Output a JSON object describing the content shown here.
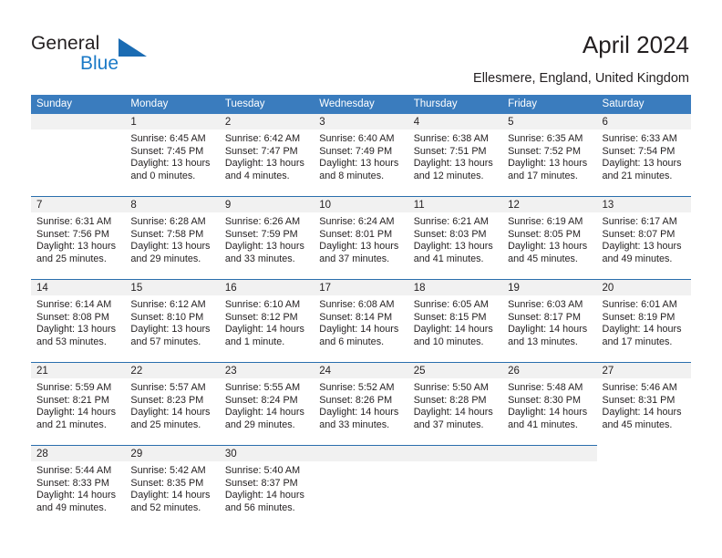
{
  "brand": {
    "name_part1": "General",
    "name_part2": "Blue",
    "accent_color": "#1b7ac7",
    "triangle_color": "#1b6cb3"
  },
  "header": {
    "title": "April 2024",
    "subtitle": "Ellesmere, England, United Kingdom"
  },
  "theme": {
    "header_row_bg": "#3a7cbe",
    "row_divider": "#2a6ead",
    "daynum_band_bg": "#f1f1f1",
    "text_color": "#231f20"
  },
  "calendar": {
    "weekday_headers": [
      "Sunday",
      "Monday",
      "Tuesday",
      "Wednesday",
      "Thursday",
      "Friday",
      "Saturday"
    ],
    "weeks": [
      [
        {
          "day": "",
          "sunrise": "",
          "sunset": "",
          "daylight1": "",
          "daylight2": ""
        },
        {
          "day": "1",
          "sunrise": "Sunrise: 6:45 AM",
          "sunset": "Sunset: 7:45 PM",
          "daylight1": "Daylight: 13 hours",
          "daylight2": "and 0 minutes."
        },
        {
          "day": "2",
          "sunrise": "Sunrise: 6:42 AM",
          "sunset": "Sunset: 7:47 PM",
          "daylight1": "Daylight: 13 hours",
          "daylight2": "and 4 minutes."
        },
        {
          "day": "3",
          "sunrise": "Sunrise: 6:40 AM",
          "sunset": "Sunset: 7:49 PM",
          "daylight1": "Daylight: 13 hours",
          "daylight2": "and 8 minutes."
        },
        {
          "day": "4",
          "sunrise": "Sunrise: 6:38 AM",
          "sunset": "Sunset: 7:51 PM",
          "daylight1": "Daylight: 13 hours",
          "daylight2": "and 12 minutes."
        },
        {
          "day": "5",
          "sunrise": "Sunrise: 6:35 AM",
          "sunset": "Sunset: 7:52 PM",
          "daylight1": "Daylight: 13 hours",
          "daylight2": "and 17 minutes."
        },
        {
          "day": "6",
          "sunrise": "Sunrise: 6:33 AM",
          "sunset": "Sunset: 7:54 PM",
          "daylight1": "Daylight: 13 hours",
          "daylight2": "and 21 minutes."
        }
      ],
      [
        {
          "day": "7",
          "sunrise": "Sunrise: 6:31 AM",
          "sunset": "Sunset: 7:56 PM",
          "daylight1": "Daylight: 13 hours",
          "daylight2": "and 25 minutes."
        },
        {
          "day": "8",
          "sunrise": "Sunrise: 6:28 AM",
          "sunset": "Sunset: 7:58 PM",
          "daylight1": "Daylight: 13 hours",
          "daylight2": "and 29 minutes."
        },
        {
          "day": "9",
          "sunrise": "Sunrise: 6:26 AM",
          "sunset": "Sunset: 7:59 PM",
          "daylight1": "Daylight: 13 hours",
          "daylight2": "and 33 minutes."
        },
        {
          "day": "10",
          "sunrise": "Sunrise: 6:24 AM",
          "sunset": "Sunset: 8:01 PM",
          "daylight1": "Daylight: 13 hours",
          "daylight2": "and 37 minutes."
        },
        {
          "day": "11",
          "sunrise": "Sunrise: 6:21 AM",
          "sunset": "Sunset: 8:03 PM",
          "daylight1": "Daylight: 13 hours",
          "daylight2": "and 41 minutes."
        },
        {
          "day": "12",
          "sunrise": "Sunrise: 6:19 AM",
          "sunset": "Sunset: 8:05 PM",
          "daylight1": "Daylight: 13 hours",
          "daylight2": "and 45 minutes."
        },
        {
          "day": "13",
          "sunrise": "Sunrise: 6:17 AM",
          "sunset": "Sunset: 8:07 PM",
          "daylight1": "Daylight: 13 hours",
          "daylight2": "and 49 minutes."
        }
      ],
      [
        {
          "day": "14",
          "sunrise": "Sunrise: 6:14 AM",
          "sunset": "Sunset: 8:08 PM",
          "daylight1": "Daylight: 13 hours",
          "daylight2": "and 53 minutes."
        },
        {
          "day": "15",
          "sunrise": "Sunrise: 6:12 AM",
          "sunset": "Sunset: 8:10 PM",
          "daylight1": "Daylight: 13 hours",
          "daylight2": "and 57 minutes."
        },
        {
          "day": "16",
          "sunrise": "Sunrise: 6:10 AM",
          "sunset": "Sunset: 8:12 PM",
          "daylight1": "Daylight: 14 hours",
          "daylight2": "and 1 minute."
        },
        {
          "day": "17",
          "sunrise": "Sunrise: 6:08 AM",
          "sunset": "Sunset: 8:14 PM",
          "daylight1": "Daylight: 14 hours",
          "daylight2": "and 6 minutes."
        },
        {
          "day": "18",
          "sunrise": "Sunrise: 6:05 AM",
          "sunset": "Sunset: 8:15 PM",
          "daylight1": "Daylight: 14 hours",
          "daylight2": "and 10 minutes."
        },
        {
          "day": "19",
          "sunrise": "Sunrise: 6:03 AM",
          "sunset": "Sunset: 8:17 PM",
          "daylight1": "Daylight: 14 hours",
          "daylight2": "and 13 minutes."
        },
        {
          "day": "20",
          "sunrise": "Sunrise: 6:01 AM",
          "sunset": "Sunset: 8:19 PM",
          "daylight1": "Daylight: 14 hours",
          "daylight2": "and 17 minutes."
        }
      ],
      [
        {
          "day": "21",
          "sunrise": "Sunrise: 5:59 AM",
          "sunset": "Sunset: 8:21 PM",
          "daylight1": "Daylight: 14 hours",
          "daylight2": "and 21 minutes."
        },
        {
          "day": "22",
          "sunrise": "Sunrise: 5:57 AM",
          "sunset": "Sunset: 8:23 PM",
          "daylight1": "Daylight: 14 hours",
          "daylight2": "and 25 minutes."
        },
        {
          "day": "23",
          "sunrise": "Sunrise: 5:55 AM",
          "sunset": "Sunset: 8:24 PM",
          "daylight1": "Daylight: 14 hours",
          "daylight2": "and 29 minutes."
        },
        {
          "day": "24",
          "sunrise": "Sunrise: 5:52 AM",
          "sunset": "Sunset: 8:26 PM",
          "daylight1": "Daylight: 14 hours",
          "daylight2": "and 33 minutes."
        },
        {
          "day": "25",
          "sunrise": "Sunrise: 5:50 AM",
          "sunset": "Sunset: 8:28 PM",
          "daylight1": "Daylight: 14 hours",
          "daylight2": "and 37 minutes."
        },
        {
          "day": "26",
          "sunrise": "Sunrise: 5:48 AM",
          "sunset": "Sunset: 8:30 PM",
          "daylight1": "Daylight: 14 hours",
          "daylight2": "and 41 minutes."
        },
        {
          "day": "27",
          "sunrise": "Sunrise: 5:46 AM",
          "sunset": "Sunset: 8:31 PM",
          "daylight1": "Daylight: 14 hours",
          "daylight2": "and 45 minutes."
        }
      ],
      [
        {
          "day": "28",
          "sunrise": "Sunrise: 5:44 AM",
          "sunset": "Sunset: 8:33 PM",
          "daylight1": "Daylight: 14 hours",
          "daylight2": "and 49 minutes."
        },
        {
          "day": "29",
          "sunrise": "Sunrise: 5:42 AM",
          "sunset": "Sunset: 8:35 PM",
          "daylight1": "Daylight: 14 hours",
          "daylight2": "and 52 minutes."
        },
        {
          "day": "30",
          "sunrise": "Sunrise: 5:40 AM",
          "sunset": "Sunset: 8:37 PM",
          "daylight1": "Daylight: 14 hours",
          "daylight2": "and 56 minutes."
        },
        {
          "day": "",
          "sunrise": "",
          "sunset": "",
          "daylight1": "",
          "daylight2": ""
        },
        {
          "day": "",
          "sunrise": "",
          "sunset": "",
          "daylight1": "",
          "daylight2": ""
        },
        {
          "day": "",
          "sunrise": "",
          "sunset": "",
          "daylight1": "",
          "daylight2": ""
        },
        {
          "day": "",
          "sunrise": "",
          "sunset": "",
          "daylight1": "",
          "daylight2": ""
        }
      ]
    ]
  }
}
